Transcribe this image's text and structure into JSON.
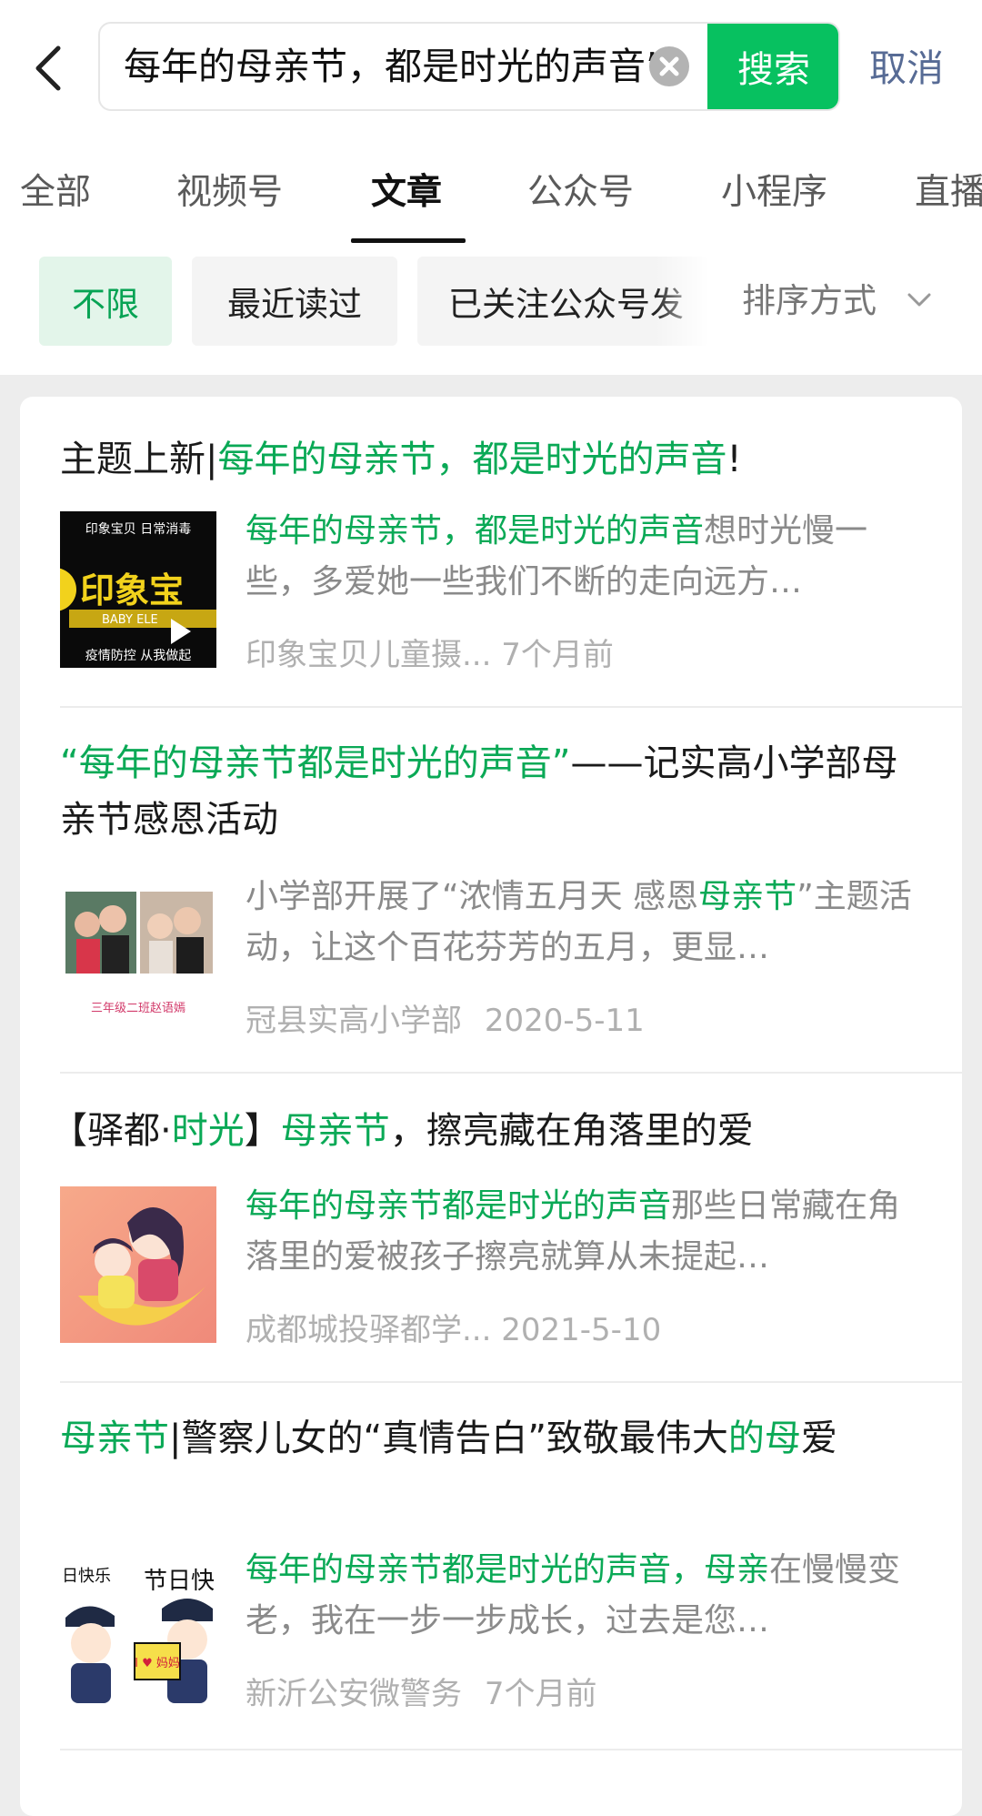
{
  "search": {
    "value": "每年的母亲节，都是时光的声音”",
    "button_label": "搜索",
    "cancel_label": "取消"
  },
  "tabs": [
    {
      "label": "全部"
    },
    {
      "label": "视频号"
    },
    {
      "label": "文章"
    },
    {
      "label": "公众号"
    },
    {
      "label": "小程序"
    },
    {
      "label": "直播"
    }
  ],
  "active_tab": "文章",
  "filters": [
    {
      "label": "不限"
    },
    {
      "label": "最近读过"
    },
    {
      "label": "已关注公众号发"
    }
  ],
  "sort_label": "排序方式",
  "results": [
    {
      "title_parts": [
        {
          "text": "主题上新|",
          "hl": false
        },
        {
          "text": "每年的母亲节，都是时光的声音",
          "hl": true
        },
        {
          "text": "!",
          "hl": false
        }
      ],
      "desc_parts": [
        {
          "text": "每年的母亲节，都是时光的声音",
          "hl": true
        },
        {
          "text": "想时光慢一些，多爱她一些我们不断的走向远方…",
          "hl": false
        }
      ],
      "source": "印象宝贝儿童摄...",
      "date": "7个月前",
      "thumb": {
        "icon": "video-thumbnail",
        "texts": [
          "印象宝贝 日常消毒",
          "印象宝",
          "BABY ELE",
          "疫情防控 从我做起"
        ]
      }
    },
    {
      "title_parts": [
        {
          "text": "“每年的母亲节都是时光的声音”",
          "hl": true
        },
        {
          "text": "——记实高小学部母亲节感恩活动",
          "hl": false
        }
      ],
      "desc_parts": [
        {
          "text": "小学部开展了“浓情五月天 感恩",
          "hl": false
        },
        {
          "text": "母亲节",
          "hl": true
        },
        {
          "text": "”主题活动，让这个百花芬芳的五月，更显…",
          "hl": false
        }
      ],
      "source": "冠县实高小学部",
      "date": "2020-5-11",
      "thumb": {
        "icon": "photo-thumbnail",
        "texts": [
          "三年级二班赵语嫣"
        ]
      }
    },
    {
      "title_parts": [
        {
          "text": "【驿都·",
          "hl": false
        },
        {
          "text": "时光",
          "hl": true
        },
        {
          "text": "】",
          "hl": false
        },
        {
          "text": "母亲节",
          "hl": true
        },
        {
          "text": "，擦亮藏在角落里的爱",
          "hl": false
        }
      ],
      "desc_parts": [
        {
          "text": "每年的母亲节都是时光的声音",
          "hl": true
        },
        {
          "text": "那些日常藏在角落里的爱被孩子擦亮就算从未提起…",
          "hl": false
        }
      ],
      "source": "成都城投驿都学...",
      "date": "2021-5-10",
      "thumb": {
        "icon": "illustration-thumbnail",
        "texts": []
      }
    },
    {
      "title_parts": [
        {
          "text": "母亲节",
          "hl": true
        },
        {
          "text": "|警察儿女的“真情告白”致敬最伟大",
          "hl": false
        },
        {
          "text": "的母",
          "hl": true
        },
        {
          "text": "爱",
          "hl": false
        }
      ],
      "desc_parts": [
        {
          "text": "每年的母亲节都是时光的声音，母亲",
          "hl": true
        },
        {
          "text": "在慢慢变老，我在一步一步成长，过去是您…",
          "hl": false
        }
      ],
      "source": "新沂公安微警务",
      "date": "7个月前",
      "thumb": {
        "icon": "cartoon-thumbnail",
        "texts": [
          "日快乐",
          "节日快",
          "I ♥ 妈妈"
        ]
      }
    }
  ],
  "colors": {
    "accent": "#07c160",
    "highlight": "#0aa956",
    "link": "#576b95",
    "background": "#ededed"
  }
}
